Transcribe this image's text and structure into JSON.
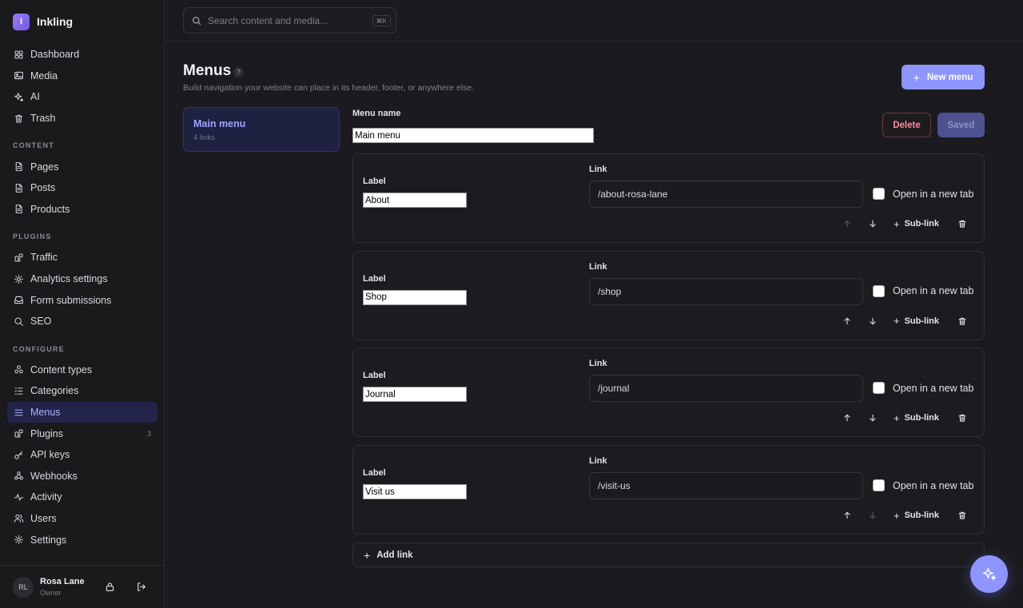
{
  "app": {
    "logo_letter": "I",
    "name": "Inkling",
    "accent": "#8e95ff"
  },
  "search": {
    "placeholder": "Search content and media...",
    "shortcut": "⌘K"
  },
  "sidebar": {
    "top_items": [
      {
        "label": "Dashboard",
        "icon": "grid-icon"
      },
      {
        "label": "Media",
        "icon": "image-icon"
      },
      {
        "label": "AI",
        "icon": "sparkle-icon"
      },
      {
        "label": "Trash",
        "icon": "trash-icon"
      }
    ],
    "sections": [
      {
        "title": "CONTENT",
        "items": [
          {
            "label": "Pages",
            "icon": "document-icon"
          },
          {
            "label": "Posts",
            "icon": "document-icon"
          },
          {
            "label": "Products",
            "icon": "document-icon"
          }
        ]
      },
      {
        "title": "PLUGINS",
        "items": [
          {
            "label": "Traffic",
            "icon": "plugin-icon"
          },
          {
            "label": "Analytics settings",
            "icon": "gear-icon"
          },
          {
            "label": "Form submissions",
            "icon": "inbox-icon"
          },
          {
            "label": "SEO",
            "icon": "search-icon"
          }
        ]
      },
      {
        "title": "CONFIGURE",
        "items": [
          {
            "label": "Content types",
            "icon": "shapes-icon"
          },
          {
            "label": "Categories",
            "icon": "list-tree-icon"
          },
          {
            "label": "Menus",
            "icon": "menu-icon",
            "active": true
          },
          {
            "label": "Plugins",
            "icon": "plugin-icon",
            "badge": "3"
          },
          {
            "label": "API keys",
            "icon": "key-icon"
          },
          {
            "label": "Webhooks",
            "icon": "webhook-icon"
          },
          {
            "label": "Activity",
            "icon": "activity-icon"
          },
          {
            "label": "Users",
            "icon": "users-icon"
          },
          {
            "label": "Settings",
            "icon": "gear-icon"
          }
        ]
      }
    ]
  },
  "user": {
    "initials": "RL",
    "name": "Rosa Lane",
    "role": "Owner"
  },
  "page": {
    "title": "Menus",
    "help": "?",
    "subtitle": "Build navigation your website can place in its header, footer, or anywhere else.",
    "new_button": "New menu"
  },
  "menus": [
    {
      "name": "Main menu",
      "count": "4 links"
    }
  ],
  "editor": {
    "menu_name_label": "Menu name",
    "menu_name_value": "Main menu",
    "delete_label": "Delete",
    "saved_label": "Saved",
    "label_caption": "Label",
    "link_caption": "Link",
    "newtab_caption": "Open in a new tab",
    "sublink_caption": "Sub-link",
    "add_link_label": "Add link",
    "links": [
      {
        "label": "About",
        "url": "/about-rosa-lane",
        "up_enabled": false,
        "down_enabled": true
      },
      {
        "label": "Shop",
        "url": "/shop",
        "up_enabled": true,
        "down_enabled": true
      },
      {
        "label": "Journal",
        "url": "/journal",
        "up_enabled": true,
        "down_enabled": true
      },
      {
        "label": "Visit us",
        "url": "/visit-us",
        "up_enabled": true,
        "down_enabled": false
      }
    ]
  }
}
